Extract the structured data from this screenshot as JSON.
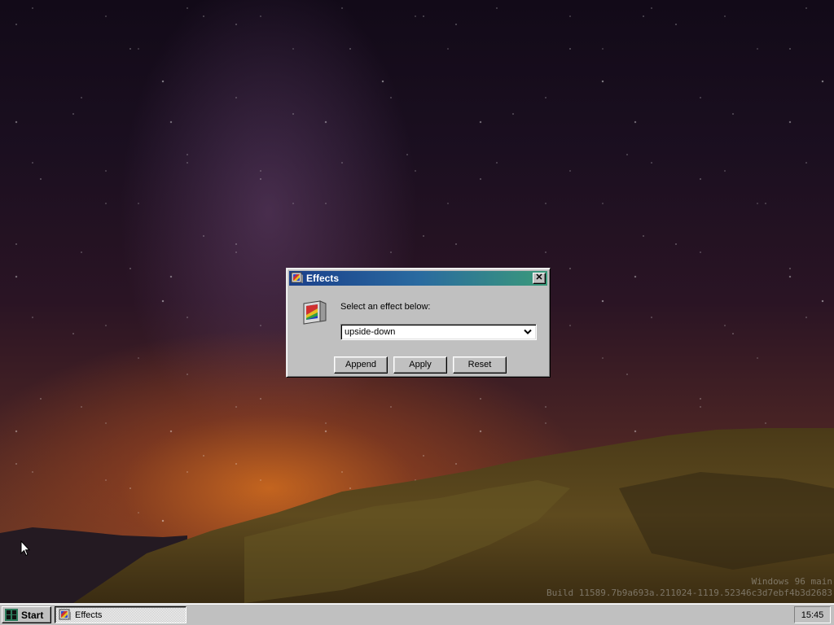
{
  "desktop": {
    "watermark_line1": "Windows 96 main",
    "watermark_line2": "Build 11589.7b9a693a.211024-1119.52346c3d7ebf4b3d2683"
  },
  "dialog": {
    "title": "Effects",
    "prompt": "Select an effect below:",
    "select": {
      "value": "upside-down"
    },
    "buttons": {
      "append": "Append",
      "apply": "Apply",
      "reset": "Reset"
    },
    "close_symbol": "✕"
  },
  "taskbar": {
    "start_label": "Start",
    "tasks": [
      {
        "label": "Effects"
      }
    ],
    "clock": "15:45"
  },
  "icons": {
    "window": "monitor-rainbow-icon",
    "start": "windows96-logo-icon",
    "dropdown": "chevron-down-icon",
    "cursor": "mouse-pointer-icon"
  },
  "colors": {
    "titlebar_start": "#1a3f8a",
    "titlebar_end": "#3a9a7a",
    "face": "#c0c0c0"
  }
}
